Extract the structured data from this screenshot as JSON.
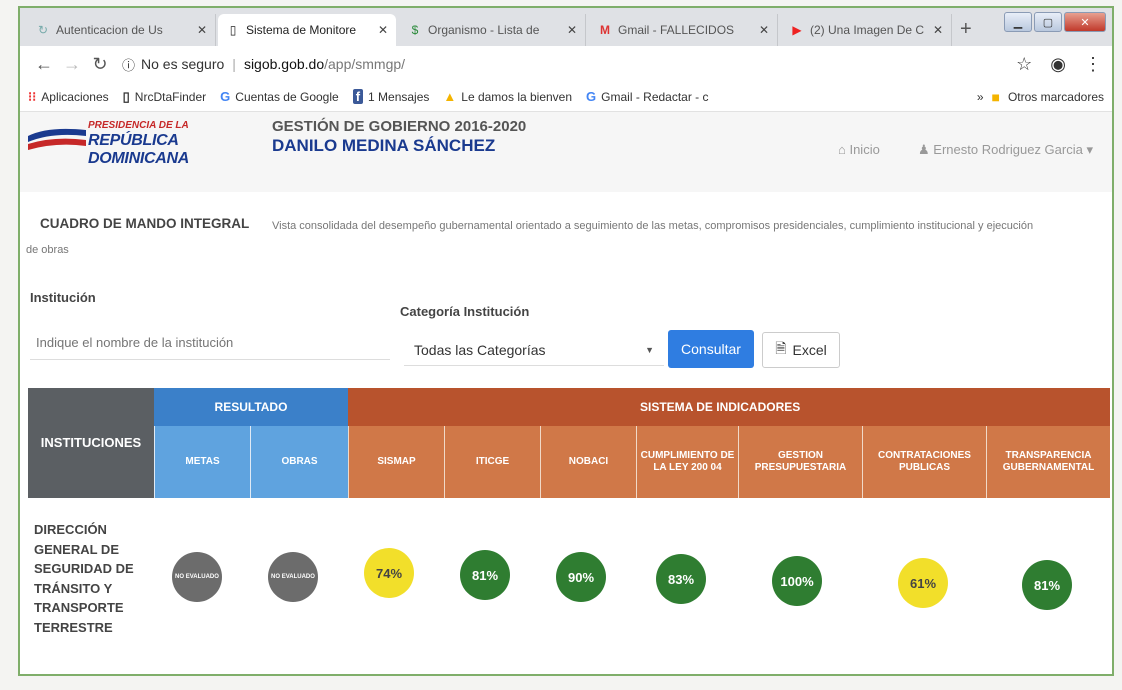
{
  "browser": {
    "tabs": [
      {
        "label": "Autenticacion de Us",
        "icon": "spinner-icon"
      },
      {
        "label": "Sistema de Monitore",
        "icon": "page-icon",
        "active": true
      },
      {
        "label": "Organismo - Lista de",
        "icon": "dollar-icon"
      },
      {
        "label": "Gmail - FALLECIDOS",
        "icon": "gmail-icon"
      },
      {
        "label": "(2) Una Imagen De C",
        "icon": "youtube-icon"
      }
    ],
    "new_tab": "+",
    "url": {
      "security": "No es seguro",
      "host": "sigob.gob.do",
      "path": "/app/smmgp/"
    },
    "bookmarks": [
      {
        "label": "Aplicaciones",
        "icon": "apps-icon"
      },
      {
        "label": "NrcDtaFinder",
        "icon": "page-icon"
      },
      {
        "label": "Cuentas de Google",
        "icon": "google-icon"
      },
      {
        "label": "1 Mensajes",
        "icon": "facebook-icon"
      },
      {
        "label": "Le damos la bienven",
        "icon": "drive-icon"
      },
      {
        "label": "Gmail - Redactar - c",
        "icon": "google-icon"
      }
    ],
    "bookmarks_overflow": "»",
    "other_bookmarks": "Otros marcadores"
  },
  "header": {
    "logo_line1": "PRESIDENCIA DE LA",
    "logo_line2": "REPÚBLICA DOMINICANA",
    "gov_line1": "GESTIÓN DE GOBIERNO 2016-2020",
    "gov_line2": "DANILO MEDINA SÁNCHEZ",
    "inicio": "Inicio",
    "user": "Ernesto Rodriguez Garcia ▾"
  },
  "intro": {
    "title": "CUADRO DE MANDO INTEGRAL",
    "description": "Vista consolidada del desempeño gubernamental orientado a seguimiento de las metas, compromisos presidenciales, cumplimiento institucional y ejecución",
    "description_cont": "de obras"
  },
  "filters": {
    "institution_label": "Institución",
    "institution_placeholder": "Indique el nombre de la institución",
    "category_label": "Categoría Institución",
    "category_value": "Todas las Categorías",
    "consultar_label": "Consultar",
    "excel_label": "Excel"
  },
  "table": {
    "inst_header": "INSTITUCIONES",
    "resultado_header": "RESULTADO",
    "indicadores_header": "SISTEMA DE INDICADORES",
    "resultado_cols": [
      "METAS",
      "OBRAS"
    ],
    "indicador_cols": [
      "SISMAP",
      "ITICGE",
      "NOBACI",
      "CUMPLIMIENTO DE LA LEY 200 04",
      "GESTION PRESUPUESTARIA",
      "CONTRATACIONES PUBLICAS",
      "TRANSPARENCIA GUBERNAMENTAL"
    ],
    "row": {
      "name_lines": [
        "DIRECCIÓN",
        "GENERAL DE",
        "SEGURIDAD DE",
        "TRÁNSITO Y",
        "TRANSPORTE",
        "TERRESTRE"
      ],
      "values": [
        {
          "text": "NO EVALUADO",
          "status": "grey"
        },
        {
          "text": "NO EVALUADO",
          "status": "grey"
        },
        {
          "text": "74%",
          "status": "yellow"
        },
        {
          "text": "81%",
          "status": "green"
        },
        {
          "text": "90%",
          "status": "green"
        },
        {
          "text": "83%",
          "status": "green"
        },
        {
          "text": "100%",
          "status": "green"
        },
        {
          "text": "61%",
          "status": "yellow"
        },
        {
          "text": "81%",
          "status": "green"
        }
      ]
    }
  },
  "colors": {
    "resultado": "#3b80c9",
    "indicadores": "#b8532d",
    "instituciones": "#5b5f63",
    "green": "#2f7d31",
    "yellow": "#f2df2a",
    "grey": "#6c6c6c"
  }
}
